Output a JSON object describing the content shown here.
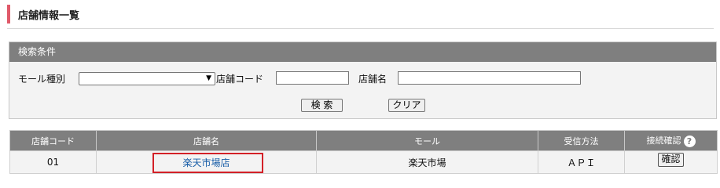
{
  "page": {
    "title": "店舗情報一覧"
  },
  "search": {
    "header": "検索条件",
    "mall_type_label": "モール種別",
    "mall_type_value": "",
    "store_code_label": "店舗コード",
    "store_code_value": "",
    "store_name_label": "店舗名",
    "store_name_value": "",
    "search_button": "検 索",
    "clear_button": "クリア"
  },
  "table": {
    "headers": [
      "店舗コード",
      "店舗名",
      "モール",
      "受信方法",
      "接続確認"
    ],
    "help_icon": "?",
    "rows": [
      {
        "code": "01",
        "name": "楽天市場店",
        "mall": "楽天市場",
        "method": "ＡＰＩ",
        "confirm": "確認"
      }
    ]
  }
}
